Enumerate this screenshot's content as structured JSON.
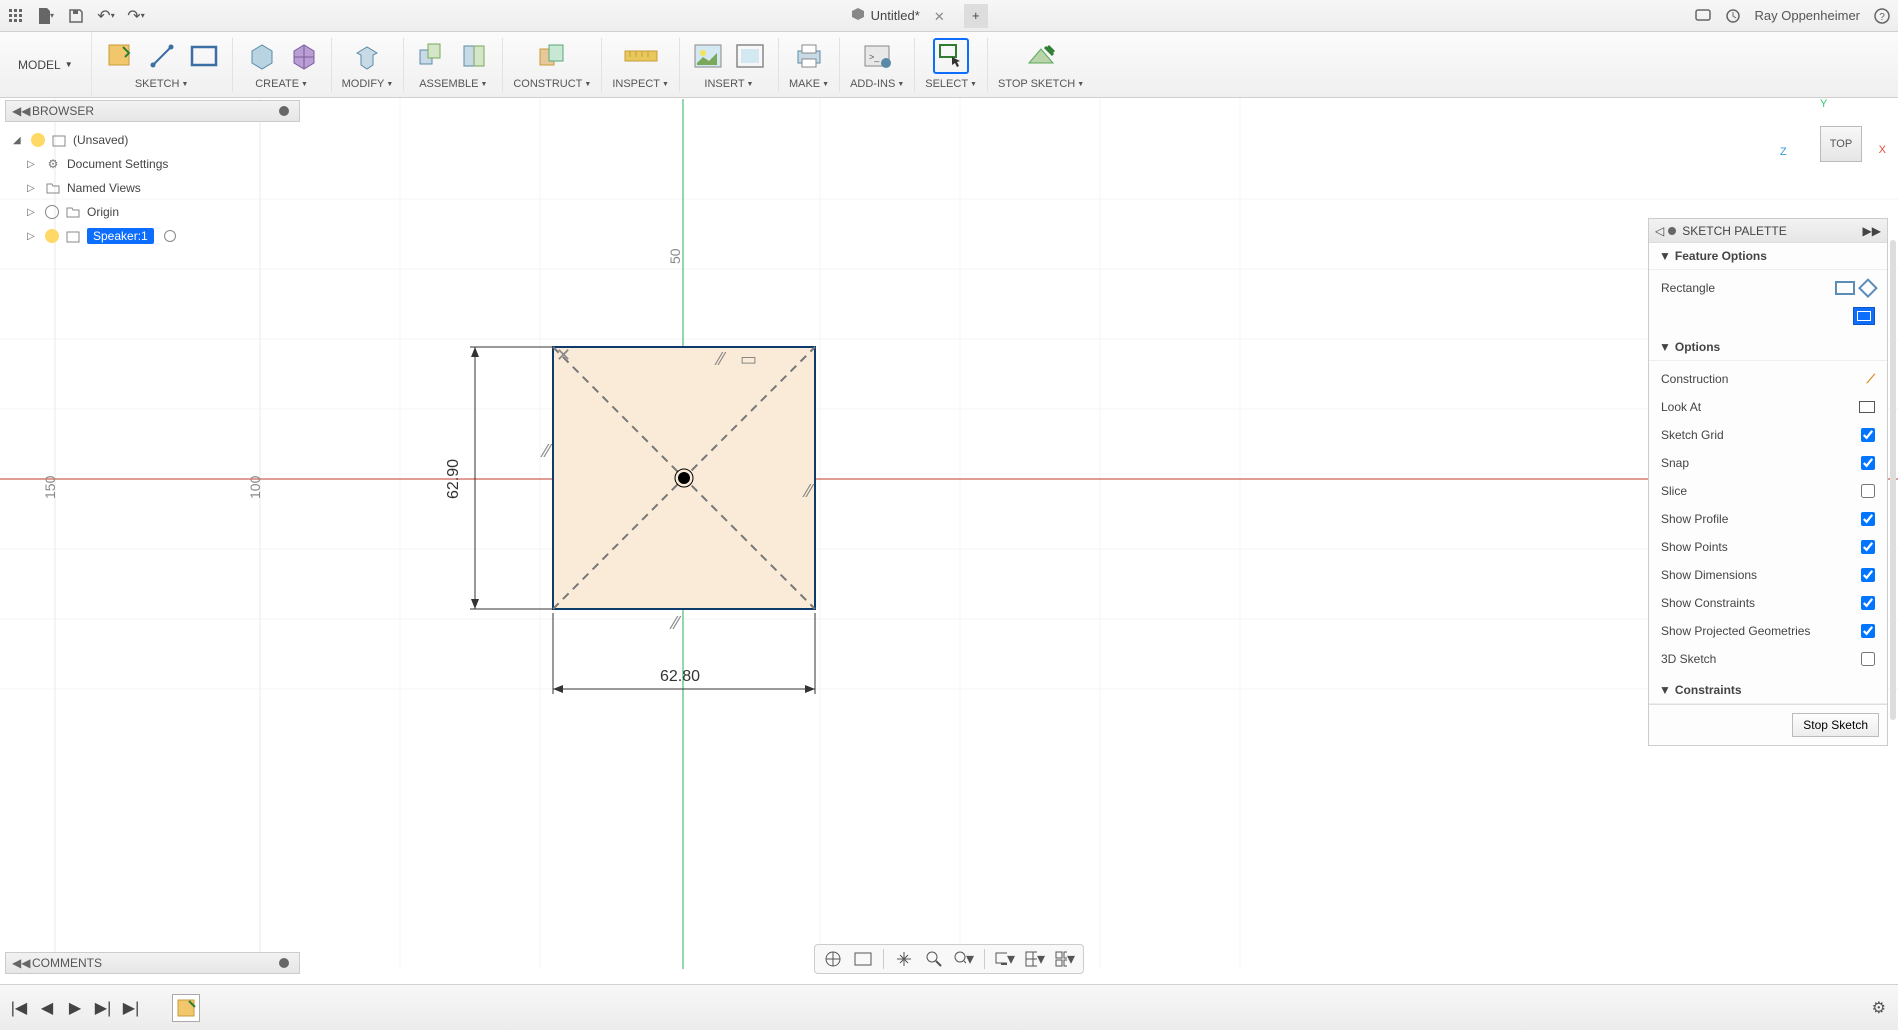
{
  "titlebar": {
    "doc_title": "Untitled*",
    "user_name": "Ray Oppenheimer"
  },
  "workspace": {
    "label": "MODEL"
  },
  "ribbon": {
    "sketch": "SKETCH",
    "create": "CREATE",
    "modify": "MODIFY",
    "assemble": "ASSEMBLE",
    "construct": "CONSTRUCT",
    "inspect": "INSPECT",
    "insert": "INSERT",
    "make": "MAKE",
    "addins": "ADD-INS",
    "select": "SELECT",
    "stop_sketch": "STOP SKETCH"
  },
  "browser": {
    "title": "BROWSER",
    "root": "(Unsaved)",
    "items": [
      {
        "label": "Document Settings"
      },
      {
        "label": "Named Views"
      },
      {
        "label": "Origin"
      },
      {
        "label": "Speaker:1"
      }
    ]
  },
  "viewcube": {
    "face": "TOP",
    "x": "X",
    "y": "Y",
    "z": "Z"
  },
  "sketch": {
    "dim_width": "62.80",
    "dim_height": "62.90",
    "ruler_50_v": "50",
    "ruler_100": "100",
    "ruler_150": "150"
  },
  "palette": {
    "title": "SKETCH PALETTE",
    "sections": {
      "feature": "Feature Options",
      "options": "Options",
      "constraints": "Constraints"
    },
    "feature": {
      "rectangle": "Rectangle"
    },
    "options": {
      "construction": "Construction",
      "look_at": "Look At",
      "sketch_grid": "Sketch Grid",
      "snap": "Snap",
      "slice": "Slice",
      "show_profile": "Show Profile",
      "show_points": "Show Points",
      "show_dimensions": "Show Dimensions",
      "show_constraints": "Show Constraints",
      "show_projected": "Show Projected Geometries",
      "sketch_3d": "3D Sketch"
    },
    "checks": {
      "sketch_grid": true,
      "snap": true,
      "slice": false,
      "show_profile": true,
      "show_points": true,
      "show_dimensions": true,
      "show_constraints": true,
      "show_projected": true,
      "sketch_3d": false
    },
    "stop": "Stop Sketch"
  },
  "comments": {
    "title": "COMMENTS"
  }
}
